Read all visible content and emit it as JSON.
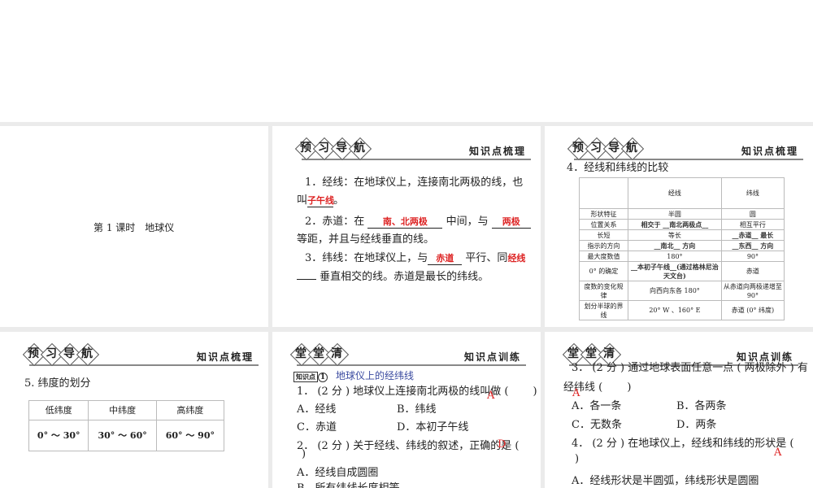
{
  "slide1": {
    "title": "第 1 课时　地球仪"
  },
  "headers": {
    "preview": [
      "预",
      "习",
      "导",
      "航"
    ],
    "preview_tag": "知识点梳理",
    "class": [
      "堂",
      "堂",
      "清"
    ],
    "class_tag": "知识点训练"
  },
  "slide2": {
    "q1a": "1．经线：在地球仪上，连接南北两极的线，也",
    "q1b_pre": "叫",
    "q1_ans": "子午线",
    "q1b_post": "。",
    "q2_pre": "2．赤道：在",
    "q2_ans1": "南、北两极",
    "q2_mid": "中间，与",
    "q2_ans2": "两极",
    "q2b": "等距，并且与经线垂直的线。",
    "q3_pre": "3．纬线：在地球仪上，与",
    "q3_ans1": "赤道",
    "q3_mid": "平行、同",
    "q3_ans2": "经线",
    "q3b": "垂直相交的线。赤道是最长的纬线。"
  },
  "slide3": {
    "heading": "4．经线和纬线的比较",
    "columns": [
      "",
      "经线",
      "纬线"
    ],
    "rows": [
      [
        "形状特征",
        "半圆",
        "圆"
      ],
      [
        "位置关系",
        "相交于 __南北两极点__",
        "相互平行"
      ],
      [
        "长短",
        "等长",
        "__赤道__ 最长"
      ],
      [
        "指示的方向",
        "__南北__ 方向",
        "__东西__ 方向"
      ],
      [
        "最大度数值",
        "180°",
        "90°"
      ],
      [
        "0° 的确定",
        "__本初子午线__(通过格林尼治天文台)",
        "赤道"
      ],
      [
        "度数的变化规律",
        "向西向东各 180°",
        "从赤道向两极递增至 90°"
      ],
      [
        "划分半球的界线",
        "20° W 、160° E",
        "赤道 (0° 纬度)"
      ]
    ]
  },
  "slide4": {
    "heading": "5. 纬度的划分",
    "columns": [
      "低纬度",
      "中纬度",
      "高纬度"
    ],
    "values": [
      "0° ～ 30°",
      "30° ～ 60°",
      "60° ～ 90°"
    ]
  },
  "slide5": {
    "tag": "知识点",
    "num": "1",
    "kp": "地球仪上的经纬线",
    "q1": "1． (2 分 ) 地球仪上连接南北两极的线叫做 (　　 )",
    "q1_ans": "A",
    "q1_opts": [
      "A．经线",
      "B．纬线",
      "C．赤道",
      "D．本初子午线"
    ],
    "q2": "2． (2 分 ) 关于经线、纬线的叙述，正确的是 (",
    "q2b": ")",
    "q2_ans": "D",
    "q2_opts": [
      "A．经线自成圆圈",
      "B．所有纬线长度相等"
    ]
  },
  "slide6": {
    "q3": "3． (2 分 ) 通过地球表面任意一点 ( 两极除外 ) 有",
    "q3b": "经纬线 (　　 )",
    "q3_ans": "A",
    "q3_opts": [
      "A．各一条",
      "B．各两条",
      "C．无数条",
      "D．两条"
    ],
    "q4": "4． (2 分 ) 在地球仪上，经线和纬线的形状是 (",
    "q4b": ")",
    "q4_ans": "A",
    "q4_opts": [
      "A．经线形状是半圆弧，纬线形状是圆圈"
    ]
  },
  "colors": {
    "answer": "#dd2222",
    "kp": "#3a4aa0"
  }
}
